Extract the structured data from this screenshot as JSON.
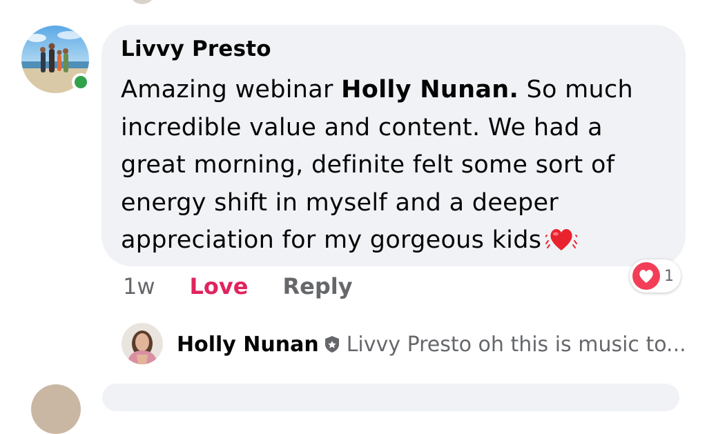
{
  "comment": {
    "author": "Livvy Presto",
    "text_before": "Amazing webinar ",
    "mention": "Holly Nunan.",
    "text_after": " So much incredible value and content. We had a great morning, definite felt some sort of energy shift in myself and a deeper appreciation for my gorgeous kids",
    "emoji": "beating-heart-emoji",
    "time": "1w",
    "reaction_label": "Love",
    "reply_label": "Reply",
    "reaction_count": "1",
    "author_online": true
  },
  "reply": {
    "author": "Holly Nunan",
    "snippet": "Livvy Presto oh this is music to..."
  },
  "colors": {
    "bubble": "#f0f2f5",
    "love": "#e0245e",
    "online": "#31a24c",
    "muted": "#65676b"
  }
}
